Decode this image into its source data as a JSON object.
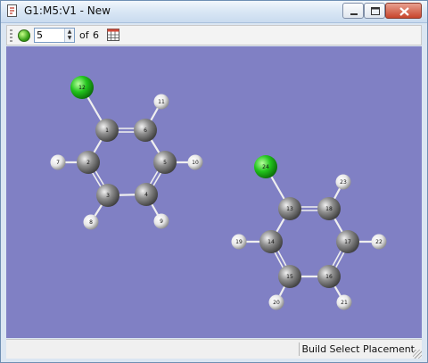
{
  "window": {
    "title": "G1:M5:V1 - New",
    "controls": {
      "minimize": "minimize",
      "maximize": "maximize",
      "close": "close"
    }
  },
  "toolbar": {
    "frame_value": "5",
    "of_label": "of",
    "total_frames": "6",
    "icons": [
      "green-status-icon",
      "table-icon"
    ]
  },
  "status": {
    "text": "Build  Select Placement"
  },
  "colors": {
    "canvas_bg": "#8080c4",
    "carbon": "#8e8e8e",
    "hydrogen": "#e6e6e6",
    "chlorine": "#22c41d",
    "bond": "#efefef"
  },
  "molecule": {
    "atoms": [
      {
        "id": "1",
        "el": "C"
      },
      {
        "id": "2",
        "el": "C"
      },
      {
        "id": "3",
        "el": "C"
      },
      {
        "id": "4",
        "el": "C"
      },
      {
        "id": "5",
        "el": "C"
      },
      {
        "id": "6",
        "el": "C"
      },
      {
        "id": "7",
        "el": "H"
      },
      {
        "id": "8",
        "el": "H"
      },
      {
        "id": "9",
        "el": "H"
      },
      {
        "id": "10",
        "el": "H"
      },
      {
        "id": "11",
        "el": "H"
      },
      {
        "id": "12",
        "el": "Cl"
      },
      {
        "id": "13",
        "el": "C"
      },
      {
        "id": "14",
        "el": "C"
      },
      {
        "id": "15",
        "el": "C"
      },
      {
        "id": "16",
        "el": "C"
      },
      {
        "id": "17",
        "el": "C"
      },
      {
        "id": "18",
        "el": "C"
      },
      {
        "id": "19",
        "el": "H"
      },
      {
        "id": "20",
        "el": "H"
      },
      {
        "id": "21",
        "el": "H"
      },
      {
        "id": "22",
        "el": "H"
      },
      {
        "id": "23",
        "el": "H"
      },
      {
        "id": "24",
        "el": "Cl"
      }
    ],
    "bonds": [
      [
        "1",
        "2"
      ],
      [
        "2",
        "3"
      ],
      [
        "3",
        "4"
      ],
      [
        "4",
        "5"
      ],
      [
        "5",
        "6"
      ],
      [
        "6",
        "1"
      ],
      [
        "1",
        "12"
      ],
      [
        "2",
        "7"
      ],
      [
        "3",
        "8"
      ],
      [
        "4",
        "9"
      ],
      [
        "5",
        "10"
      ],
      [
        "6",
        "11"
      ],
      [
        "13",
        "14"
      ],
      [
        "14",
        "15"
      ],
      [
        "15",
        "16"
      ],
      [
        "16",
        "17"
      ],
      [
        "17",
        "18"
      ],
      [
        "18",
        "13"
      ],
      [
        "13",
        "24"
      ],
      [
        "14",
        "19"
      ],
      [
        "15",
        "20"
      ],
      [
        "16",
        "21"
      ],
      [
        "17",
        "22"
      ],
      [
        "18",
        "23"
      ]
    ],
    "double_bonds": [
      [
        "1",
        "6"
      ],
      [
        "2",
        "3"
      ],
      [
        "4",
        "5"
      ],
      [
        "13",
        "18"
      ],
      [
        "14",
        "15"
      ],
      [
        "16",
        "17"
      ]
    ]
  }
}
